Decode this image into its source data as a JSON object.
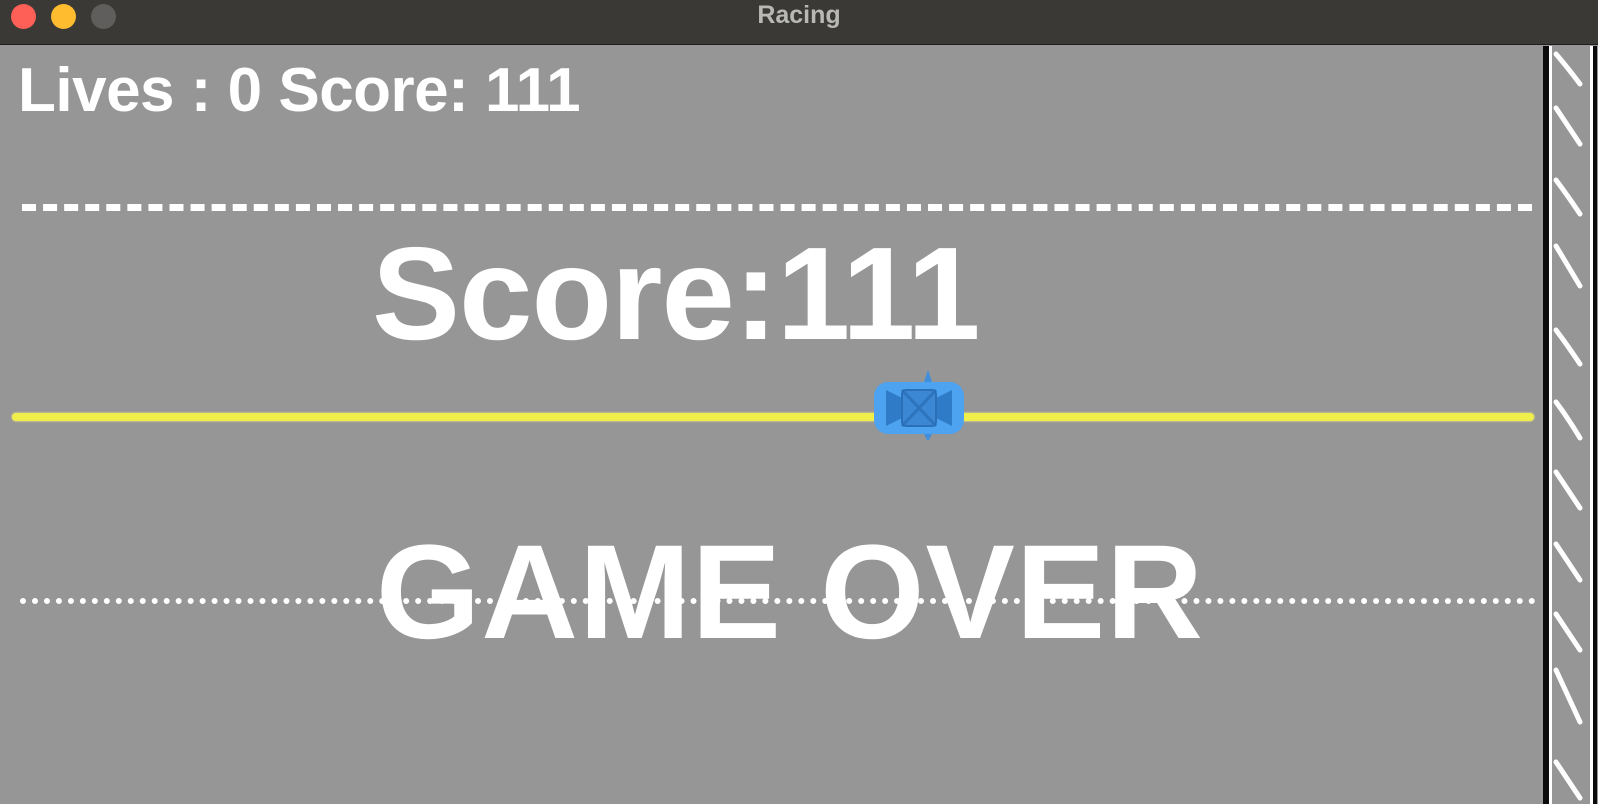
{
  "window": {
    "title": "Racing"
  },
  "hud": {
    "text": "Lives : 0 Score: 111"
  },
  "overlay": {
    "score_text": "Score:111",
    "game_over_text": "GAME OVER"
  },
  "colors": {
    "road": "#969696",
    "lane_divider": "#f0ee4a",
    "car": "#4ea3f0",
    "text": "#ffffff"
  },
  "icons": {
    "car": "blue-car-topdown",
    "traffic_lights": [
      "close",
      "minimize",
      "zoom"
    ]
  }
}
